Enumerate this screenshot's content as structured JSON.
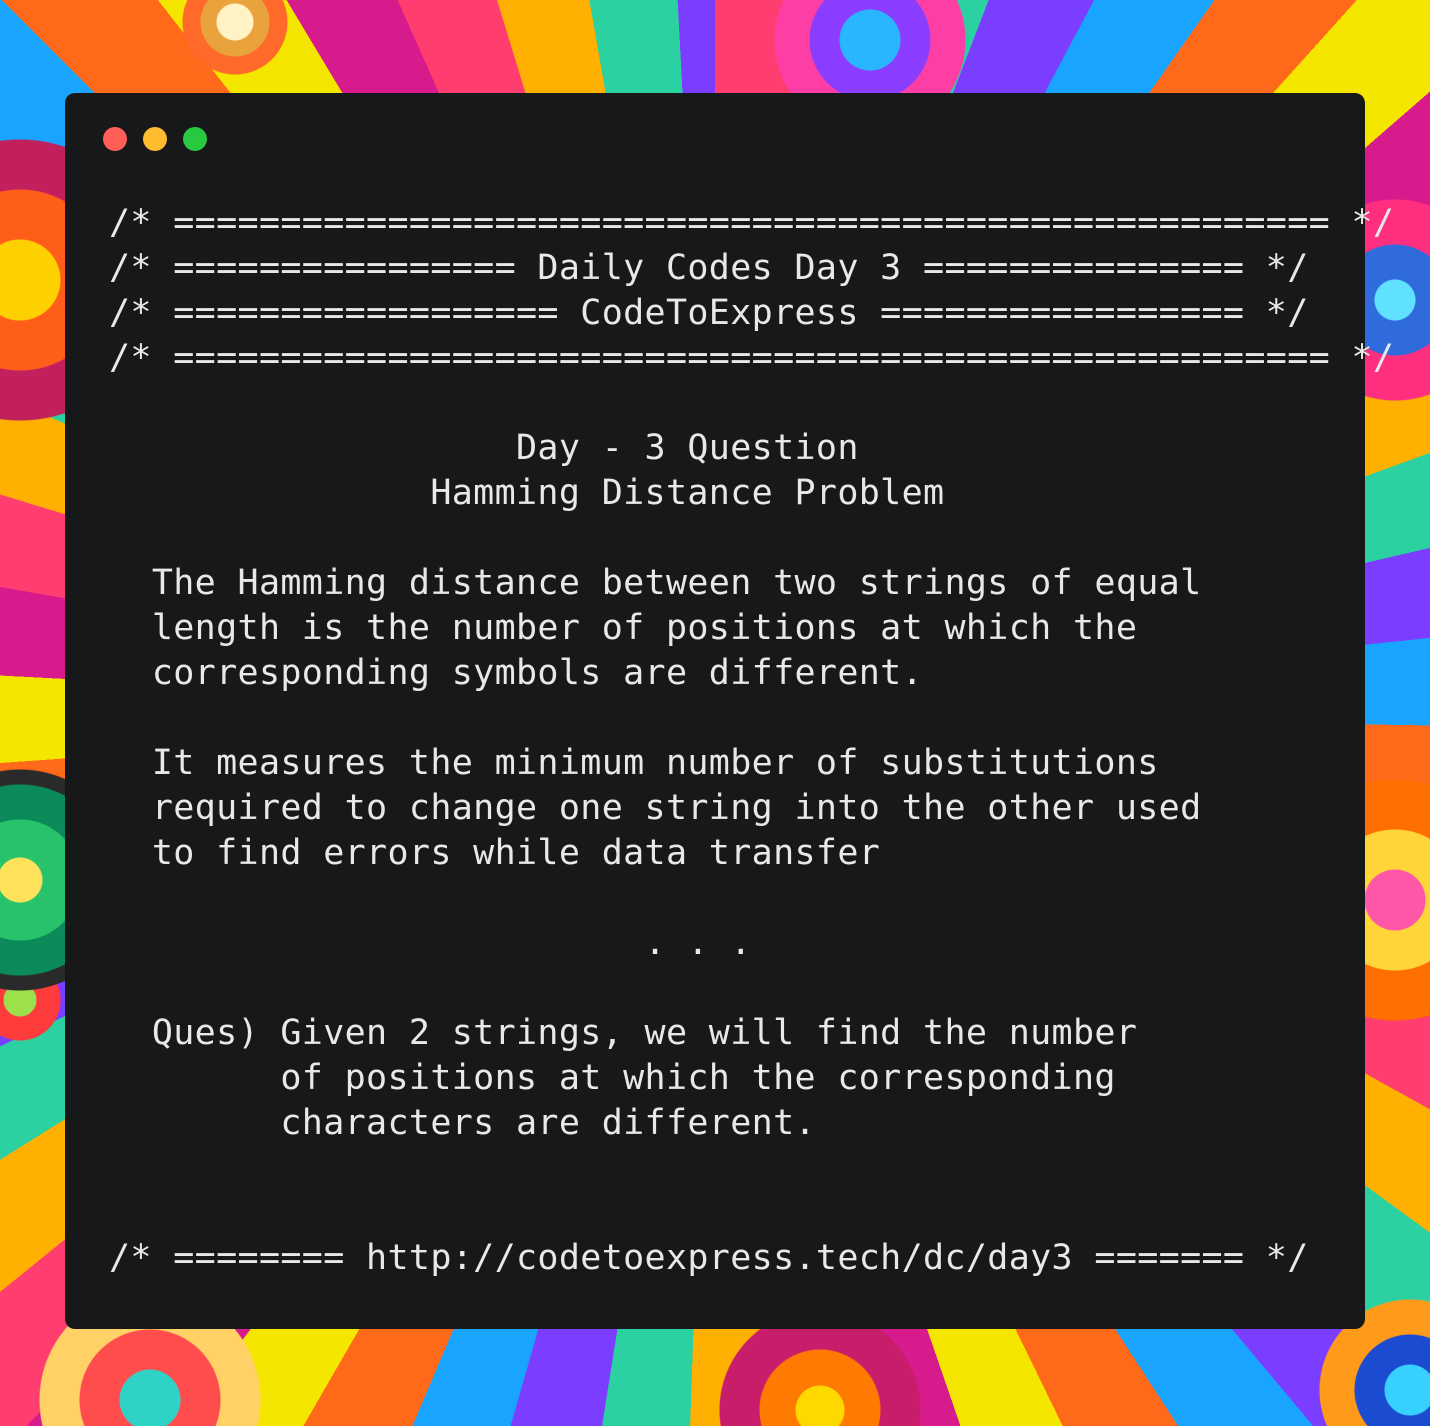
{
  "window": {
    "controls": [
      "close",
      "minimize",
      "zoom"
    ],
    "colors": {
      "close": "#ff5f57",
      "minimize": "#febc2e",
      "zoom": "#28c840",
      "background": "#17181a",
      "text": "#e8e8e8"
    }
  },
  "code": {
    "header": [
      "/* ====================================================== */",
      "/* ================ Daily Codes Day 3 =============== */",
      "/* ================== CodeToExpress ================= */",
      "/* ====================================================== */"
    ],
    "question_title": "                   Day - 3 Question",
    "problem_title": "               Hamming Distance Problem",
    "paragraph1": [
      "  The Hamming distance between two strings of equal",
      "  length is the number of positions at which the",
      "  corresponding symbols are different."
    ],
    "paragraph2": [
      "  It measures the minimum number of substitutions",
      "  required to change one string into the other used",
      "  to find errors while data transfer"
    ],
    "ellipsis": "                         . . .",
    "question": [
      "  Ques) Given 2 strings, we will find the number",
      "        of positions at which the corresponding",
      "        characters are different."
    ],
    "footer": "/* ======== http://codetoexpress.tech/dc/day3 ======= */"
  }
}
